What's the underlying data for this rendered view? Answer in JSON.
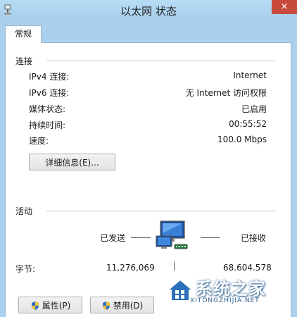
{
  "window": {
    "title": "以太网 状态",
    "close_glyph": "×"
  },
  "tabs": [
    {
      "label": "常规"
    }
  ],
  "connection": {
    "heading": "连接",
    "rows": [
      {
        "label": "IPv4 连接:",
        "value": "Internet"
      },
      {
        "label": "IPv6 连接:",
        "value": "无 Internet 访问权限"
      },
      {
        "label": "媒体状态:",
        "value": "已启用"
      },
      {
        "label": "持续时间:",
        "value": "00:55:52"
      },
      {
        "label": "速度:",
        "value": "100.0 Mbps"
      }
    ],
    "details_button": "详细信息(E)..."
  },
  "activity": {
    "heading": "活动",
    "sent_label": "已发送",
    "received_label": "已接收",
    "bytes_label": "字节:",
    "bytes_sent": "11,276,069",
    "bytes_received": "68.604.578"
  },
  "buttons": {
    "properties": "属性(P)",
    "disable": "禁用(D)"
  },
  "watermark": {
    "text": "系统之家",
    "subtext": "XITONGZHIJIA.NET"
  },
  "icons": {
    "title": "network-connection-icon",
    "activity": "network-computers-icon",
    "shield": "uac-shield-icon"
  },
  "colors": {
    "frame": "#a9d1ef",
    "close": "#c74a3c",
    "panel": "#ffffff"
  }
}
